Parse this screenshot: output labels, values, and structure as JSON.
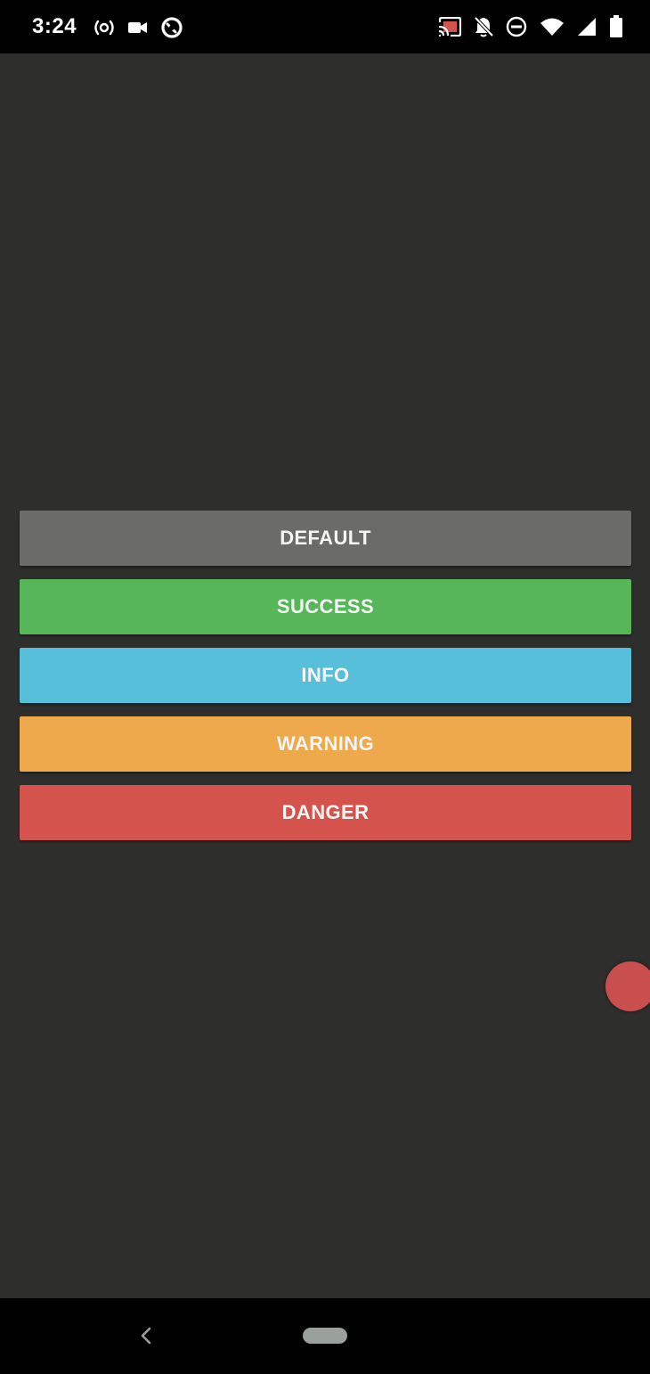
{
  "status_bar": {
    "time": "3:24",
    "left_icons": [
      "hotspot-icon",
      "video-camera-icon",
      "data-saver-icon"
    ],
    "right_icons": [
      "cast-icon",
      "notifications-off-icon",
      "do-not-disturb-icon",
      "wifi-icon",
      "cell-signal-icon",
      "battery-icon"
    ]
  },
  "buttons": [
    {
      "label": "DEFAULT",
      "color": "#6b6b68"
    },
    {
      "label": "SUCCESS",
      "color": "#57b65a"
    },
    {
      "label": "INFO",
      "color": "#57bfd9"
    },
    {
      "label": "WARNING",
      "color": "#eda94c"
    },
    {
      "label": "DANGER",
      "color": "#d5534d"
    }
  ],
  "floating_bubble": {
    "color": "#c94f4f"
  },
  "nav_bar": {
    "icons": [
      "back-icon",
      "home-pill-icon"
    ]
  },
  "theme": {
    "background": "#2e2f2d",
    "bars": "#000000"
  }
}
